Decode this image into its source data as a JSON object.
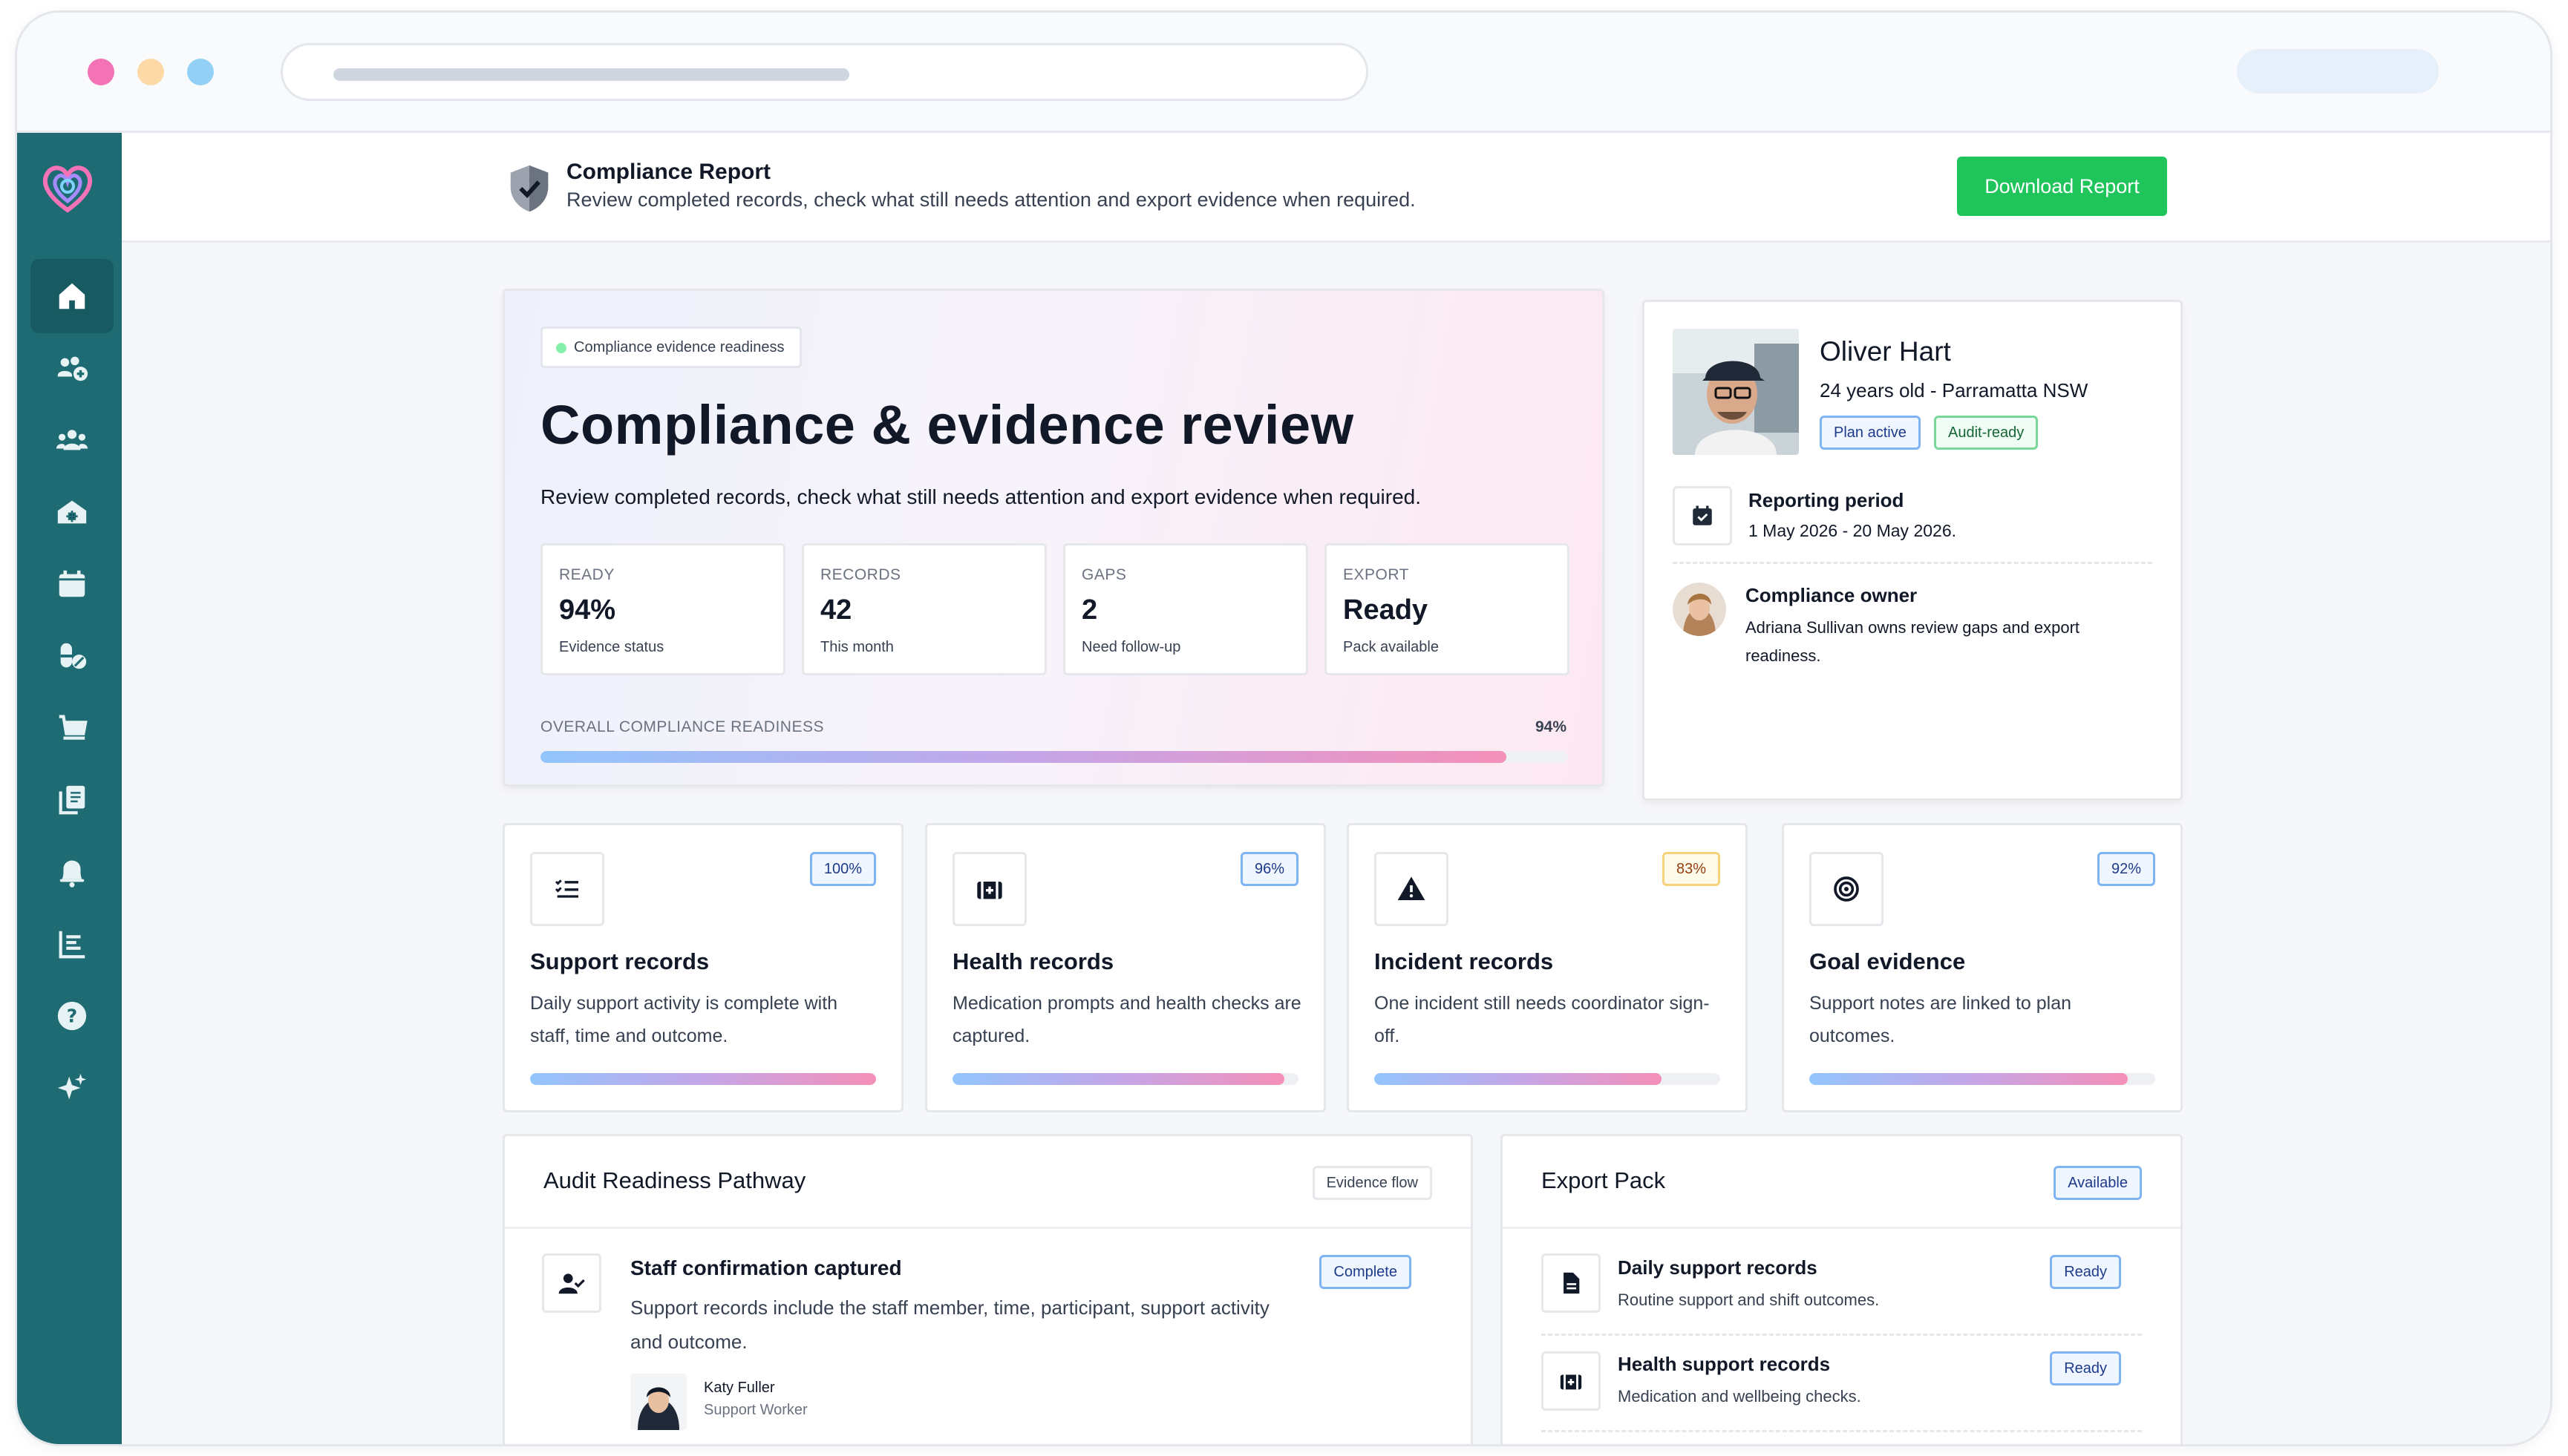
{
  "header": {
    "title": "Compliance Report",
    "subtitle": "Review completed records, check what still needs attention and export evidence when required.",
    "download_label": "Download Report"
  },
  "sidebar": {
    "items": [
      {
        "icon": "home-icon",
        "active": true
      },
      {
        "icon": "users-add-icon"
      },
      {
        "icon": "team-icon"
      },
      {
        "icon": "house-icon"
      },
      {
        "icon": "calendar-icon"
      },
      {
        "icon": "medication-icon"
      },
      {
        "icon": "cart-icon"
      },
      {
        "icon": "documents-icon"
      },
      {
        "icon": "bell-icon"
      },
      {
        "icon": "report-list-icon"
      },
      {
        "icon": "help-icon"
      },
      {
        "icon": "sparkle-icon"
      }
    ]
  },
  "hero": {
    "badge": "Compliance evidence readiness",
    "title": "Compliance & evidence review",
    "description": "Review completed records, check what still needs attention and export evidence when required.",
    "stats": [
      {
        "label": "READY",
        "value": "94%",
        "caption": "Evidence status"
      },
      {
        "label": "RECORDS",
        "value": "42",
        "caption": "This month"
      },
      {
        "label": "GAPS",
        "value": "2",
        "caption": "Need follow-up"
      },
      {
        "label": "EXPORT",
        "value": "Ready",
        "caption": "Pack available"
      }
    ],
    "readiness_label": "OVERALL COMPLIANCE READINESS",
    "readiness_pct": "94%",
    "readiness_fraction": 0.94
  },
  "profile": {
    "name": "Oliver Hart",
    "meta": "24 years old - Parramatta NSW",
    "tags": [
      "Plan active",
      "Audit-ready"
    ],
    "period_title": "Reporting period",
    "period_value": "1 May 2026 - 20 May 2026.",
    "owner_title": "Compliance owner",
    "owner_text": "Adriana Sullivan owns review gaps and export readiness."
  },
  "metrics": [
    {
      "title": "Support records",
      "description": "Daily support activity is complete with staff, time and outcome.",
      "pct": "100%",
      "fraction": 1.0,
      "icon": "checklist-icon",
      "tone": "blue"
    },
    {
      "title": "Health records",
      "description": "Medication prompts and health checks are captured.",
      "pct": "96%",
      "fraction": 0.96,
      "icon": "medical-kit-icon",
      "tone": "blue"
    },
    {
      "title": "Incident records",
      "description": "One incident still needs coordinator sign-off.",
      "pct": "83%",
      "fraction": 0.83,
      "icon": "warning-icon",
      "tone": "amber"
    },
    {
      "title": "Goal evidence",
      "description": "Support notes are linked to plan outcomes.",
      "pct": "92%",
      "fraction": 0.92,
      "icon": "target-icon",
      "tone": "blue"
    }
  ],
  "pathway": {
    "title": "Audit Readiness Pathway",
    "tag": "Evidence flow",
    "step_title": "Staff confirmation captured",
    "step_status": "Complete",
    "step_description": "Support records include the staff member, time, participant, support activity and outcome.",
    "person_name": "Katy Fuller",
    "person_role": "Support Worker"
  },
  "export": {
    "title": "Export Pack",
    "tag": "Available",
    "rows": [
      {
        "title": "Daily support records",
        "description": "Routine support and shift outcomes.",
        "status": "Ready",
        "icon": "document-icon"
      },
      {
        "title": "Health support records",
        "description": "Medication and wellbeing checks.",
        "status": "Ready",
        "icon": "medical-kit-icon"
      }
    ]
  },
  "colors": {
    "sidebar": "#1f6b73",
    "accent_green": "#1fc45b",
    "progress_start": "#93c5fd",
    "progress_end": "#f48fb8"
  }
}
